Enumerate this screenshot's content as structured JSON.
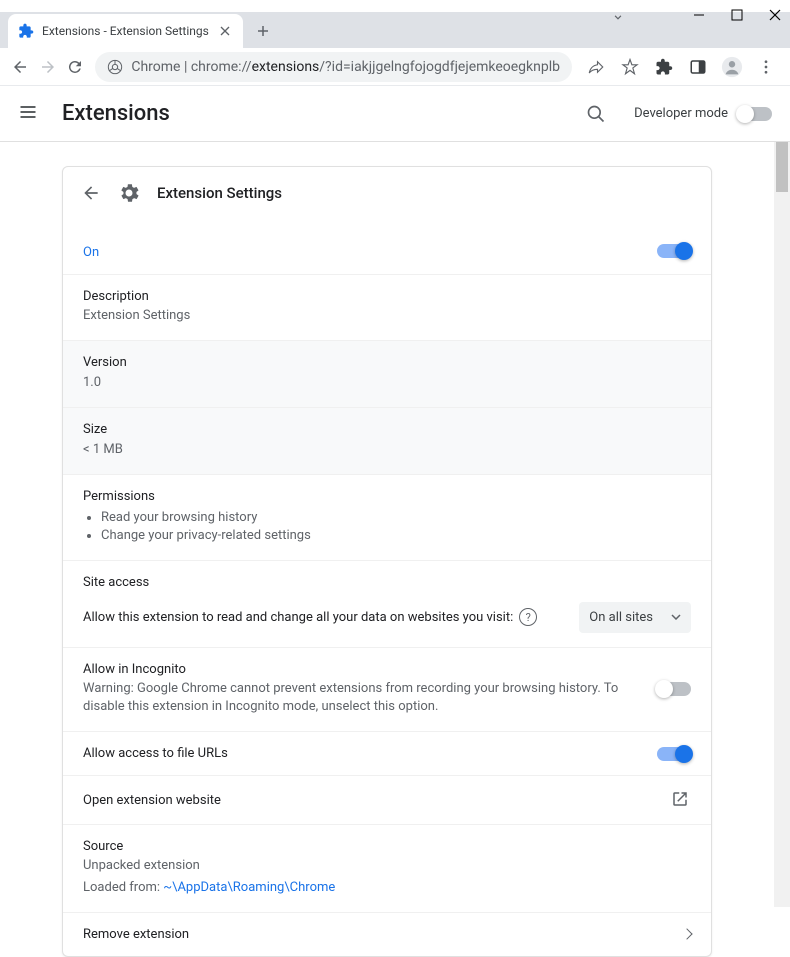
{
  "window": {
    "tab_title": "Extensions - Extension Settings"
  },
  "omnibox": {
    "prefix": "Chrome",
    "url_proto": "chrome://",
    "url_bold": "extensions",
    "url_rest": "/?id=iakjjgelngfojogdfjejemkeoegknplb"
  },
  "header": {
    "title": "Extensions",
    "devmode": "Developer mode"
  },
  "card": {
    "title": "Extension Settings",
    "status": "On",
    "description_label": "Description",
    "description_value": "Extension Settings",
    "version_label": "Version",
    "version_value": "1.0",
    "size_label": "Size",
    "size_value": "< 1 MB",
    "permissions_label": "Permissions",
    "permissions": [
      "Read your browsing history",
      "Change your privacy-related settings"
    ],
    "site_access_label": "Site access",
    "site_access_desc": "Allow this extension to read and change all your data on websites you visit:",
    "site_access_value": "On all sites",
    "incognito_label": "Allow in Incognito",
    "incognito_warning": "Warning: Google Chrome cannot prevent extensions from recording your browsing history. To disable this extension in Incognito mode, unselect this option.",
    "file_urls_label": "Allow access to file URLs",
    "open_website": "Open extension website",
    "source_label": "Source",
    "source_line1": "Unpacked extension",
    "source_prefix": "Loaded from: ",
    "source_path": "~\\AppData\\Roaming\\Chrome",
    "remove": "Remove extension"
  }
}
